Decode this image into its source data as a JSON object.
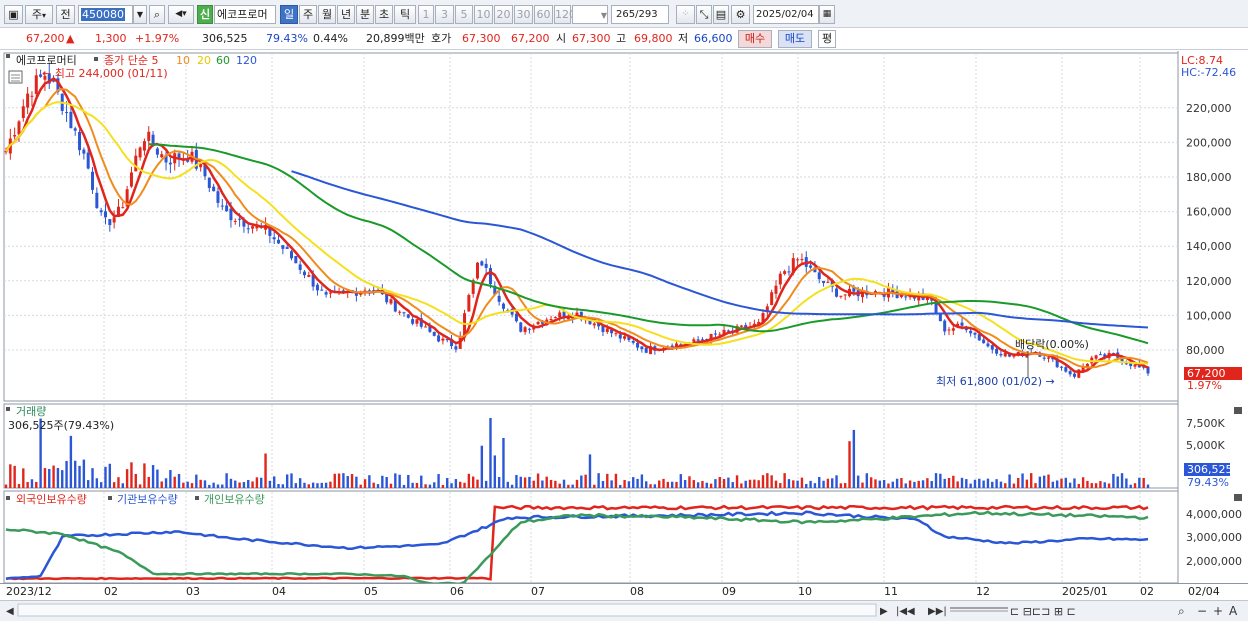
{
  "toolbar": {
    "period_label": "주",
    "prev_label": "전",
    "code": "450080",
    "sin_label": "신",
    "stock_name": "에코프로머",
    "intervals": [
      "일",
      "주",
      "월",
      "년",
      "분",
      "초",
      "틱"
    ],
    "active_interval": "일",
    "ranges": [
      "1",
      "3",
      "5",
      "10",
      "20",
      "30",
      "60",
      "120"
    ],
    "count": "265",
    "count_total": "/293",
    "date": "2025/02/04"
  },
  "quote": {
    "price": "67,200",
    "change": "1,300",
    "change_pct": "+1.97%",
    "volume": "306,525",
    "volume_ratio": "79.43%",
    "turnover_pct": "0.44%",
    "amount": "20,899백만",
    "bid_label": "호가",
    "bid": "67,300",
    "ask": "67,200",
    "open_label": "시",
    "open": "67,300",
    "high_label": "고",
    "high": "69,800",
    "low_label": "저",
    "low": "66,600",
    "buy_label": "매수",
    "sell_label": "매도",
    "eval_label": "평"
  },
  "price_pane": {
    "legend_name": "에코프로머티",
    "legend_items": [
      {
        "label": "종가 단순 5",
        "color": "#e0261c"
      },
      {
        "label": "10",
        "color": "#f08c1e"
      },
      {
        "label": "20",
        "color": "#f5e020"
      },
      {
        "label": "60",
        "color": "#1a9a2a"
      },
      {
        "label": "120",
        "color": "#2b57d6"
      }
    ],
    "high_note": "최고 244,000 (01/11)",
    "low_note": "최저 61,800 (01/02)",
    "dividend_note": "배당락(0.00%)",
    "lc": "LC:8.74",
    "hc": "HC:-72.46",
    "current_price": "67,200",
    "current_pct": "1.97%",
    "y_ticks": [
      "220,000",
      "200,000",
      "180,000",
      "160,000",
      "140,000",
      "120,000",
      "100,000",
      "80,000"
    ]
  },
  "volume_pane": {
    "title": "거래량",
    "volume_note": "306,525주(79.43%)",
    "y_ticks": [
      "7,500K",
      "5,000K"
    ],
    "current": "306,525",
    "current_pct": "79.43%"
  },
  "holding_pane": {
    "legend_items": [
      {
        "label": "외국인보유수량",
        "color": "#e0261c"
      },
      {
        "label": "기관보유수량",
        "color": "#2b57d6"
      },
      {
        "label": "개인보유수량",
        "color": "#3a9a5a"
      }
    ],
    "y_ticks": [
      "4,000,000",
      "3,000,000",
      "2,000,000"
    ]
  },
  "x_axis": {
    "labels": [
      "2023/12",
      "02",
      "03",
      "04",
      "05",
      "06",
      "07",
      "08",
      "09",
      "10",
      "11",
      "12",
      "2025/01",
      "02",
      "02/04"
    ]
  },
  "colors": {
    "ma5": "#e0261c",
    "ma10": "#f08c1e",
    "ma20": "#f5e020",
    "ma60": "#1a9a2a",
    "ma120": "#2b57d6",
    "up": "#e0261c",
    "down": "#2b57d6"
  },
  "chart_data": {
    "type": "line",
    "title": "에코프로머티",
    "x": [
      "2023/12",
      "02",
      "03",
      "04",
      "05",
      "06",
      "07",
      "08",
      "09",
      "10",
      "11",
      "12",
      "2025/01",
      "02"
    ],
    "ylim": [
      60000,
      250000
    ],
    "series": [
      {
        "name": "종가 단순 5",
        "values": [
          200000,
          160000,
          188000,
          150000,
          118000,
          100000,
          88000,
          128000,
          96000,
          92000,
          85000,
          90000,
          138000,
          112000,
          90000,
          76000,
          65000,
          72000,
          68000
        ]
      },
      {
        "name": "60",
        "values": [
          null,
          null,
          170000,
          186000,
          178000,
          150000,
          122000,
          106000,
          96000,
          92000,
          95000,
          99000,
          104000,
          108000,
          104000,
          98000,
          88000,
          84000
        ]
      },
      {
        "name": "120",
        "values": [
          null,
          null,
          null,
          null,
          null,
          152000,
          150000,
          140000,
          126000,
          108000,
          100000,
          99000,
          99000,
          98000,
          96000,
          93000,
          92000
        ]
      }
    ],
    "high": 244000,
    "low": 61800
  }
}
